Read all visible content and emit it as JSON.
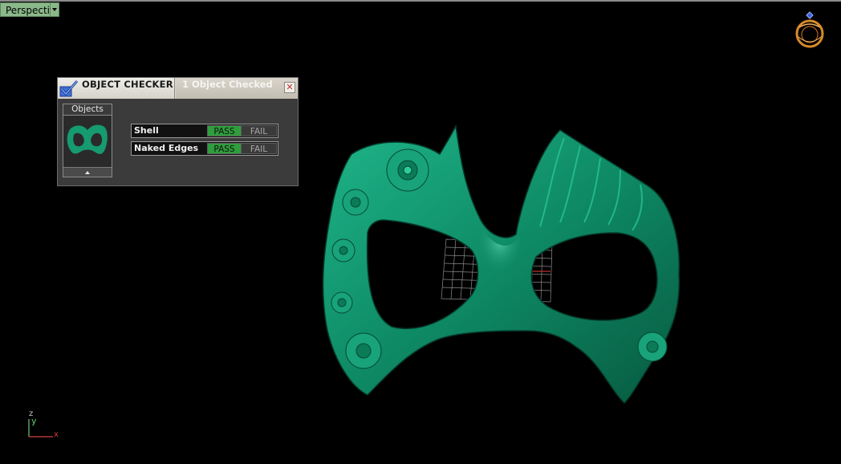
{
  "viewport": {
    "name": "Perspective",
    "background": "#000000"
  },
  "axes": {
    "z": "z",
    "y": "y",
    "x": "x"
  },
  "gizmo": {
    "icon": "ring-icon"
  },
  "object_checker": {
    "title": "OBJECT CHECKER",
    "count_text": "1  Object Checked",
    "close_icon": "close-icon",
    "objects_label": "Objects",
    "checks": [
      {
        "name": "Shell",
        "pass": "PASS",
        "fail": "FAIL",
        "status": "pass"
      },
      {
        "name": "Naked Edges",
        "pass": "PASS",
        "fail": "FAIL",
        "status": "pass"
      }
    ]
  },
  "colors": {
    "mask": "#0e8a64",
    "pass": "#2f9e3d",
    "tab": "#8ab88a"
  }
}
